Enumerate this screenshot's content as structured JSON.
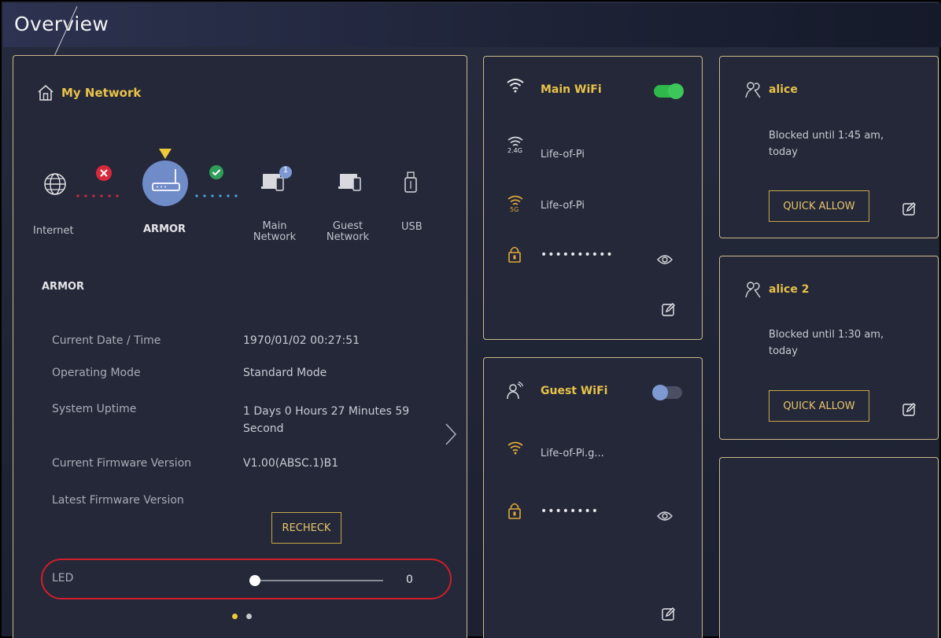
{
  "page": {
    "title": "Overview"
  },
  "my_network": {
    "title": "My Network",
    "nodes": {
      "internet": "Internet",
      "armor": "ARMOR",
      "main_network": "Main\nNetwork",
      "guest_network": "Guest\nNetwork",
      "usb": "USB"
    },
    "main_network_badge": "1",
    "internet_status": "error",
    "armor_status": "ok",
    "device_heading": "ARMOR",
    "info": [
      {
        "label": "Current Date / Time",
        "value": "1970/01/02 00:27:51"
      },
      {
        "label": "Operating Mode",
        "value": "Standard Mode"
      },
      {
        "label": "System Uptime",
        "value": "1 Days 0 Hours 27 Minutes 59 Second"
      },
      {
        "label": "Current Firmware Version",
        "value": "V1.00(ABSC.1)B1"
      },
      {
        "label": "Latest Firmware Version",
        "value": ""
      }
    ],
    "recheck_label": "RECHECK",
    "led": {
      "label": "LED",
      "value": "0",
      "level": 0
    },
    "pager": {
      "pages": 2,
      "active": 0
    }
  },
  "main_wifi": {
    "title": "Main WiFi",
    "enabled": true,
    "band_24_label": "2.4G",
    "ssid_24": "Life-of-Pi",
    "band_5_label": "5G",
    "ssid_5": "Life-of-Pi",
    "password_mask": "••••••••••"
  },
  "guest_wifi": {
    "title": "Guest WiFi",
    "enabled": false,
    "ssid": "Life-of-Pi.g...",
    "password_mask": "••••••••"
  },
  "profiles": [
    {
      "name": "alice",
      "status": "Blocked until 1:45 am, today",
      "button": "QUICK ALLOW"
    },
    {
      "name": "alice 2",
      "status": "Blocked until 1:30 am, today",
      "button": "QUICK ALLOW"
    }
  ],
  "colors": {
    "accent_gold": "#e8c24a",
    "toggle_on": "#2eb84c",
    "error_red": "#d8283a",
    "ok_green": "#2e9e5a",
    "router_blue": "#6f8bc8"
  }
}
